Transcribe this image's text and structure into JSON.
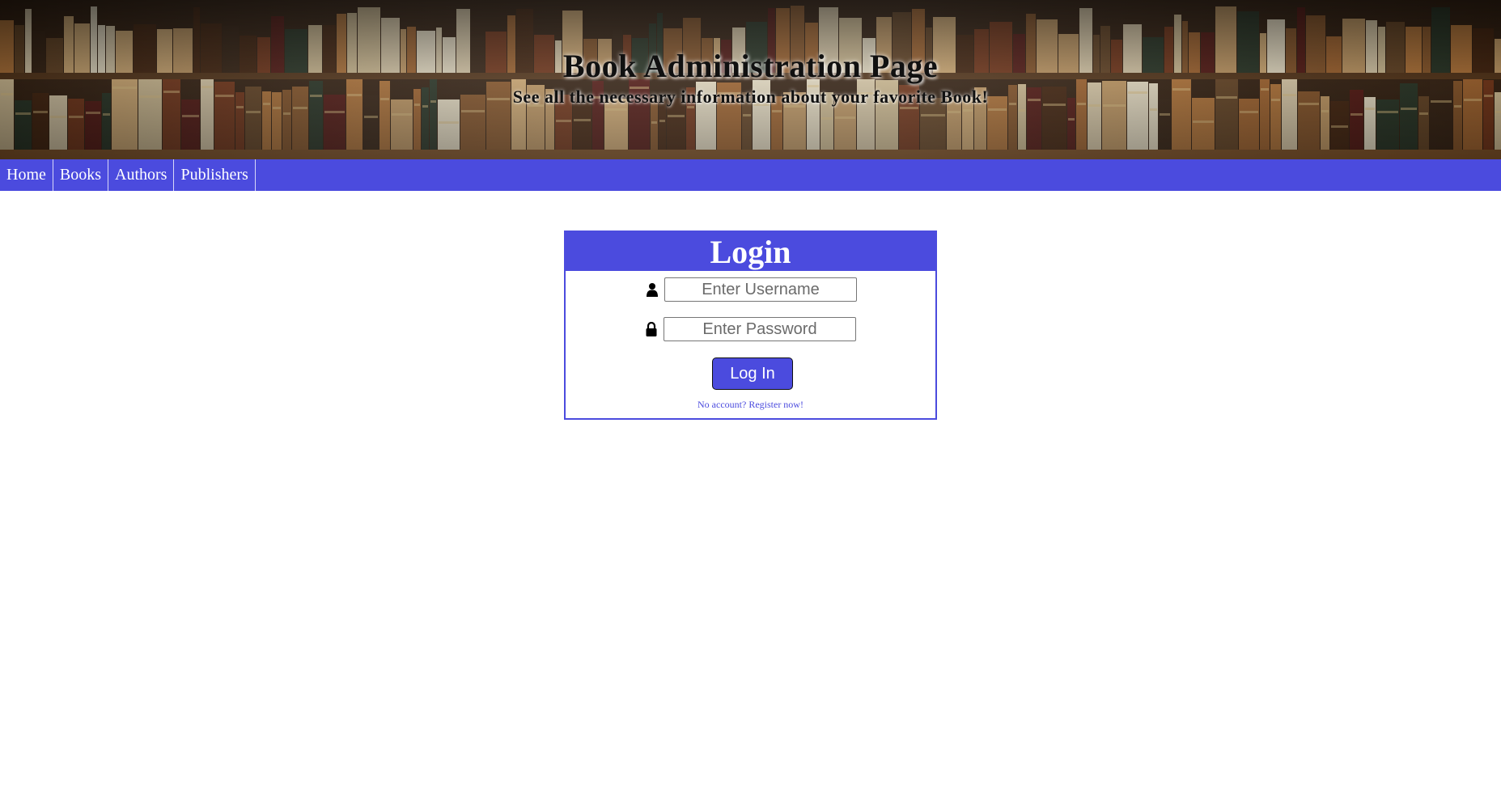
{
  "header": {
    "title": "Book Administration Page",
    "subtitle": "See all the necessary information about your favorite Book!"
  },
  "nav": {
    "items": [
      {
        "label": "Home"
      },
      {
        "label": "Books"
      },
      {
        "label": "Authors"
      },
      {
        "label": "Publishers"
      }
    ]
  },
  "login": {
    "title": "Login",
    "username": {
      "placeholder": "Enter Username",
      "value": "",
      "icon": "user-icon"
    },
    "password": {
      "placeholder": "Enter Password",
      "value": "",
      "icon": "lock-icon"
    },
    "submit_label": "Log In",
    "register_link": "No account? Register now!"
  },
  "colors": {
    "accent": "#4b4bde",
    "background": "#ffffff",
    "text_dark": "#111111"
  }
}
